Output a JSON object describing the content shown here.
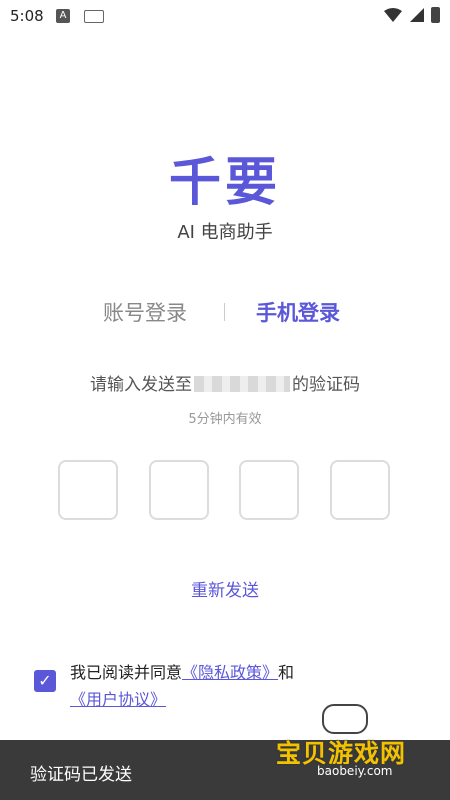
{
  "status_bar": {
    "time": "5:08",
    "notif_letter": "A"
  },
  "app": {
    "logo": "千要",
    "subtitle": "AI 电商助手"
  },
  "tabs": {
    "account": "账号登录",
    "phone": "手机登录"
  },
  "verify": {
    "prompt_prefix": "请输入发送至",
    "prompt_suffix": "的验证码",
    "validity": "5分钟内有效"
  },
  "code_boxes": [
    "",
    "",
    "",
    ""
  ],
  "resend": "重新发送",
  "agreement": {
    "prefix": "我已阅读并同意",
    "privacy": "《隐私政策》",
    "and": "和",
    "user": "《用户协议》",
    "checked": true
  },
  "toast": "验证码已发送",
  "watermark": {
    "brand": "宝贝游戏网",
    "url": "baobeiy.com"
  },
  "colors": {
    "accent": "#5b57d9",
    "toast_bg": "#3a3a3a"
  }
}
